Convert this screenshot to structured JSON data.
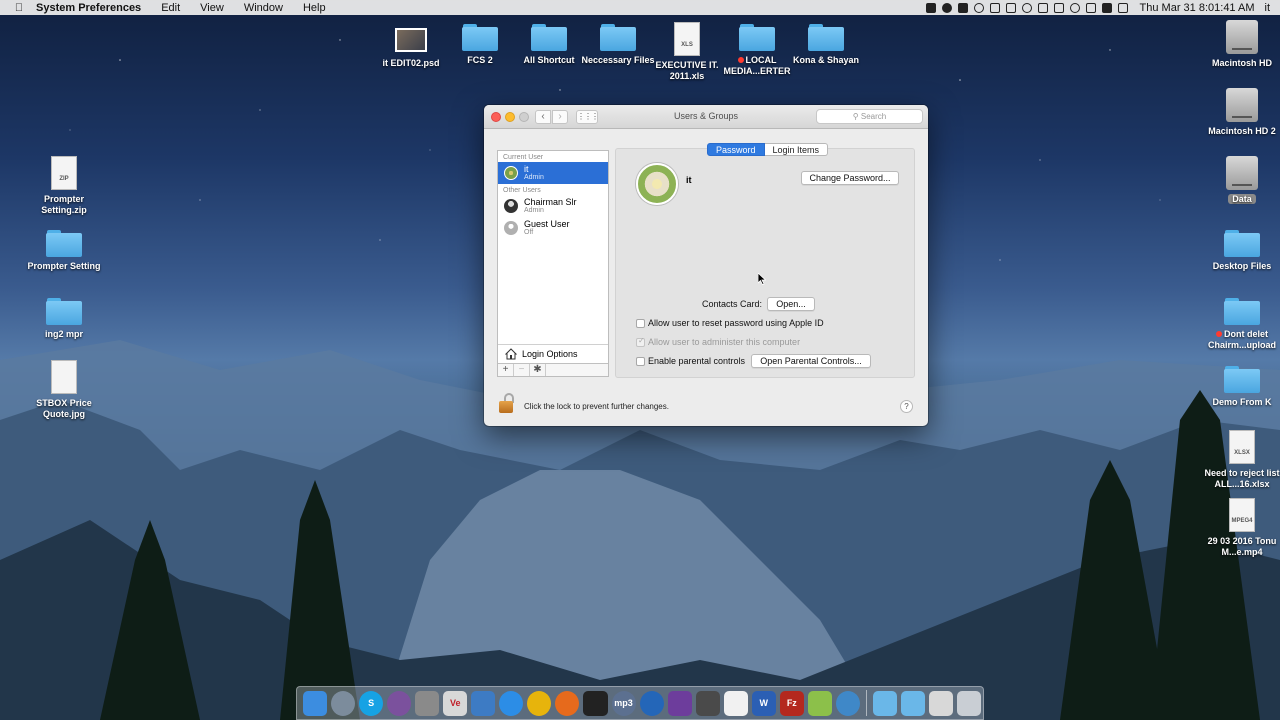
{
  "menubar": {
    "app_name": "System Preferences",
    "menus": [
      "Edit",
      "View",
      "Window",
      "Help"
    ],
    "clock": "Thu Mar 31  8:01:41 AM",
    "user": "it"
  },
  "desktop_top": [
    {
      "label": "it EDIT02.psd",
      "kind": "photo"
    },
    {
      "label": "FCS 2",
      "kind": "folder"
    },
    {
      "label": "All Shortcut",
      "kind": "folder"
    },
    {
      "label": "Neccessary Files",
      "kind": "folder"
    },
    {
      "label": "EXECUTIVE IT. 2011.xls",
      "kind": "file",
      "badge": "XLS"
    },
    {
      "label": "LOCAL MEDIA...ERTER",
      "kind": "folder",
      "tag": "red"
    },
    {
      "label": "Kona & Shayan",
      "kind": "folder"
    }
  ],
  "desktop_left": [
    {
      "label": "Prompter Setting.zip",
      "kind": "file",
      "badge": "ZIP"
    },
    {
      "label": "Prompter Setting",
      "kind": "folder"
    },
    {
      "label": "ing2 mpr",
      "kind": "folder"
    },
    {
      "label": "STBOX Price Quote.jpg",
      "kind": "file",
      "badge": ""
    }
  ],
  "desktop_right": [
    {
      "label": "Macintosh HD",
      "kind": "disk"
    },
    {
      "label": "Macintosh HD 2",
      "kind": "disk"
    },
    {
      "label": "Data",
      "kind": "disk",
      "selected": true
    },
    {
      "label": "Desktop Files",
      "kind": "folder"
    },
    {
      "label": "Dont delet Chairm...upload",
      "kind": "folder",
      "tag": "red"
    },
    {
      "label": "Demo From K",
      "kind": "folder"
    },
    {
      "label": "Need to reject list ALL...16.xlsx",
      "kind": "file",
      "badge": "XLSX"
    },
    {
      "label": "29 03 2016 Tonu M...e.mp4",
      "kind": "file",
      "badge": "MPEG4"
    }
  ],
  "window": {
    "title": "Users & Groups",
    "search_placeholder": "Search",
    "sections": {
      "current": "Current User",
      "other": "Other Users"
    },
    "users": [
      {
        "name": "it",
        "role": "Admin",
        "selected": true,
        "avatar": "flower"
      },
      {
        "name": "Chairman Slr",
        "role": "Admin",
        "selected": false,
        "avatar": "dark"
      },
      {
        "name": "Guest User",
        "role": "Off",
        "selected": false,
        "avatar": "guest"
      }
    ],
    "login_options": "Login Options",
    "list_buttons": {
      "add": "+",
      "remove": "−",
      "action": "✱"
    },
    "tabs": [
      {
        "label": "Password",
        "active": true
      },
      {
        "label": "Login Items",
        "active": false
      }
    ],
    "selected_name": "it",
    "change_password": "Change Password...",
    "contacts_label": "Contacts Card:",
    "open_button": "Open...",
    "options": [
      {
        "label": "Allow user to reset password using Apple ID",
        "checked": false,
        "enabled": true
      },
      {
        "label": "Allow user to administer this computer",
        "checked": true,
        "enabled": false
      },
      {
        "label": "Enable parental controls",
        "checked": false,
        "enabled": true
      }
    ],
    "parental_button": "Open Parental Controls...",
    "lock_text": "Click the lock to prevent further changes.",
    "help": "?"
  },
  "dock": [
    {
      "name": "finder",
      "color": "#3c8de0"
    },
    {
      "name": "launchpad",
      "color": "#7c8c9c"
    },
    {
      "name": "skype",
      "color": "#16a2e4",
      "glyph": "S"
    },
    {
      "name": "viber",
      "color": "#7b519d"
    },
    {
      "name": "system-preferences",
      "color": "#8a8a8a"
    },
    {
      "name": "ve",
      "color": "#d8d8d8",
      "glyph": "Ve"
    },
    {
      "name": "preview",
      "color": "#3d7bc4"
    },
    {
      "name": "safari",
      "color": "#2c8de6"
    },
    {
      "name": "chrome",
      "color": "#e7b40c"
    },
    {
      "name": "firefox",
      "color": "#e66a1c"
    },
    {
      "name": "claquette",
      "color": "#222222"
    },
    {
      "name": "mp3",
      "color": "#5c7090",
      "glyph": "mp3"
    },
    {
      "name": "quicktime",
      "color": "#2466b8"
    },
    {
      "name": "imovie",
      "color": "#6d3d9c"
    },
    {
      "name": "photos",
      "color": "#4a4a4a"
    },
    {
      "name": "textedit",
      "color": "#f1f1f1"
    },
    {
      "name": "word",
      "color": "#2b5fb4",
      "glyph": "W"
    },
    {
      "name": "filezilla",
      "color": "#b4281e",
      "glyph": "Fz"
    },
    {
      "name": "android",
      "color": "#8cc04a"
    },
    {
      "name": "network",
      "color": "#3f88c8"
    },
    {
      "name": "applications",
      "color": "#6ab7e8"
    },
    {
      "name": "documents",
      "color": "#6ab7e8"
    },
    {
      "name": "downloads",
      "color": "#d8d8d8"
    },
    {
      "name": "trash",
      "color": "#c9ced4"
    }
  ]
}
